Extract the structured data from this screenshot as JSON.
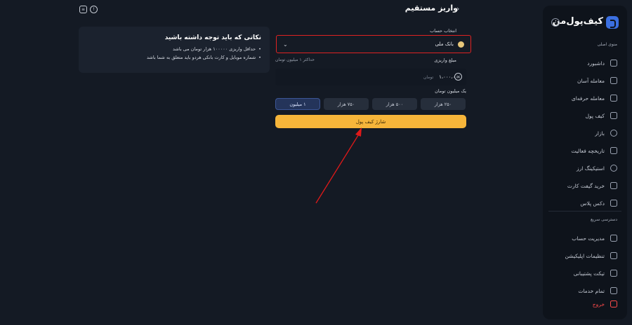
{
  "header": {
    "title": "واریز مستقیم",
    "back_icon": "chevron-right-icon",
    "left_icons": [
      "receipt-icon",
      "chat-support-icon"
    ]
  },
  "sidebar": {
    "logo_text": "کیف‌پول‌من",
    "menu_title": "منوی اصلی",
    "items": [
      {
        "label": "داشبورد",
        "icon": "dashboard-icon"
      },
      {
        "label": "معامله آسان",
        "icon": "easy-trade-icon"
      },
      {
        "label": "معامله حرفه‌ای",
        "icon": "pro-trade-icon"
      },
      {
        "label": "کیف پول",
        "icon": "wallet-icon"
      },
      {
        "label": "بازار",
        "icon": "market-icon"
      },
      {
        "label": "تاریخچه فعالیت",
        "icon": "history-icon"
      },
      {
        "label": "استیکینگ ارز",
        "icon": "staking-icon"
      },
      {
        "label": "خرید گیفت کارت",
        "icon": "gift-card-icon"
      },
      {
        "label": "دکس پلاس",
        "icon": "dex-icon"
      }
    ],
    "quick_title": "دسترسی سریع",
    "quick_items": [
      {
        "label": "مدیریت حساب",
        "icon": "account-icon"
      },
      {
        "label": "تنظیمات اپلیکیشن",
        "icon": "settings-icon"
      },
      {
        "label": "تیکت پشتیبانی",
        "icon": "ticket-icon"
      },
      {
        "label": "تمام خدمات",
        "icon": "grid-icon"
      }
    ],
    "logout": {
      "label": "خروج",
      "icon": "logout-icon"
    }
  },
  "form": {
    "account_label": "انتخاب حساب",
    "account_value": "بانک ملی",
    "amount_label": "مبلغ واریزی",
    "max_hint": "حداکثر ۱ میلیون تومان",
    "amount_value": "۱،۰۰۰،۰۰۰",
    "amount_unit": "تومان",
    "amount_words": "یک میلیون تومان",
    "chips": [
      "۲۵۰ هزار",
      "۵۰۰ هزار",
      "۷۵۰ هزار",
      "۱ میلیون"
    ],
    "active_chip": "۱ میلیون",
    "submit_label": "شارژ کیف پول"
  },
  "notes": {
    "title": "نکاتی که باید توجه داشته باشید",
    "items": [
      "حداقل واریزی ۱۰۰۰۰۰ هزار تومان می باشد",
      "شماره موبایل و کارت بانکی هردو باید متعلق به شما باشد"
    ]
  },
  "colors": {
    "background": "#141a24",
    "sidebar": "#0e131b",
    "accent": "#f6b53a",
    "highlight": "#e02222",
    "brand": "#3b6fe0"
  }
}
